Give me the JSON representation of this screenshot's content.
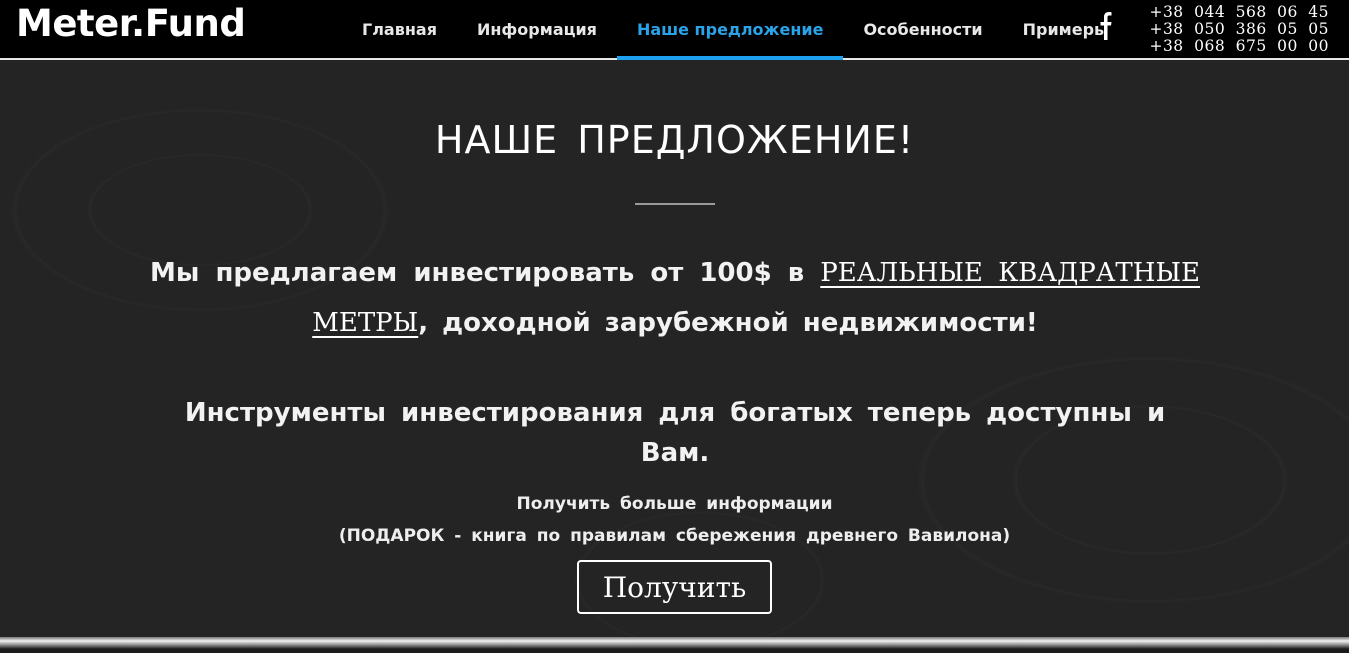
{
  "header": {
    "logo": "Meter.Fund",
    "nav": [
      {
        "label": "Главная"
      },
      {
        "label": "Информация"
      },
      {
        "label": "Наше предложение"
      },
      {
        "label": "Особенности"
      },
      {
        "label": "Примеры"
      }
    ],
    "active_nav": "Наше предложение",
    "social_icon": "facebook-icon",
    "phones": [
      "+38 044 568 06 45",
      "+38 050 386 05 05",
      "+38 068 675 00 00"
    ]
  },
  "main": {
    "title": "НАШЕ ПРЕДЛОЖЕНИЕ!",
    "lead_prefix": "Мы предлагаем инвестировать от 100$ в ",
    "lead_link": "РЕАЛЬНЫЕ КВАДРАТНЫЕ МЕТРЫ",
    "lead_suffix": ", доходной зарубежной недвижимости!",
    "lead2": "Инструменты инвестирования для богатых теперь доступны и Вам.",
    "info_line1": "Получить больше информации",
    "info_line2": "(ПОДАРОК - книга по правилам сбережения древнего Вавилона)",
    "button": "Получить"
  },
  "colors": {
    "background": "#232323",
    "header": "#000000",
    "accent": "#1ea1ef",
    "text": "#ffffff"
  }
}
